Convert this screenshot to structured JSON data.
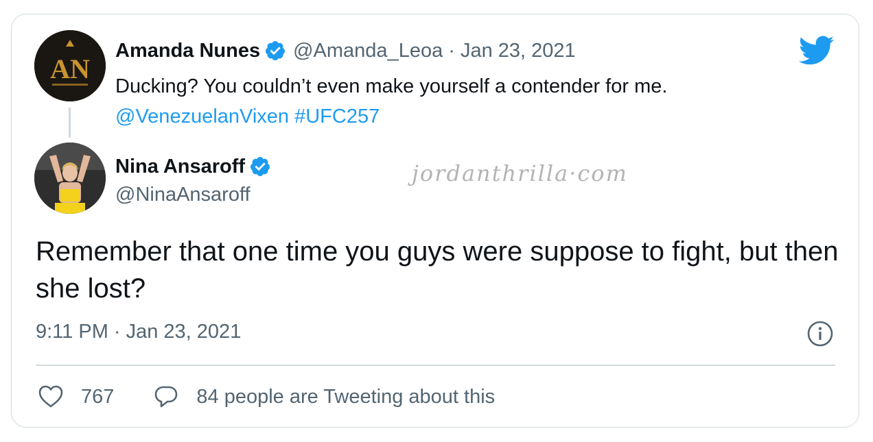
{
  "parent_tweet": {
    "author_name": "Amanda Nunes",
    "handle_and_date": "@Amanda_Leoa · Jan 23, 2021",
    "text": "Ducking? You couldn’t even make yourself a contender for me.",
    "mention": "@VenezuelanVixen",
    "hashtag": "#UFC257",
    "avatar_text": "AN"
  },
  "reply_tweet": {
    "author_name": "Nina Ansaroff",
    "handle": "@NinaAnsaroff",
    "text": "Remember that one time you guys were suppose to fight, but then she lost?",
    "timestamp": "9:11 PM · Jan 23, 2021"
  },
  "watermark": "jordanthrilla·com",
  "actions": {
    "likes_count": "767",
    "conversation_label": "84 people are Tweeting about this"
  },
  "icons": {
    "brand": "twitter-bird-icon",
    "verified": "verified-badge-icon",
    "info": "info-icon",
    "like": "heart-icon",
    "reply": "speech-bubble-icon"
  },
  "colors": {
    "link": "#1d9bf0",
    "verified": "#1d9bf0",
    "secondary_text": "#536471",
    "border": "#cfd9de"
  }
}
